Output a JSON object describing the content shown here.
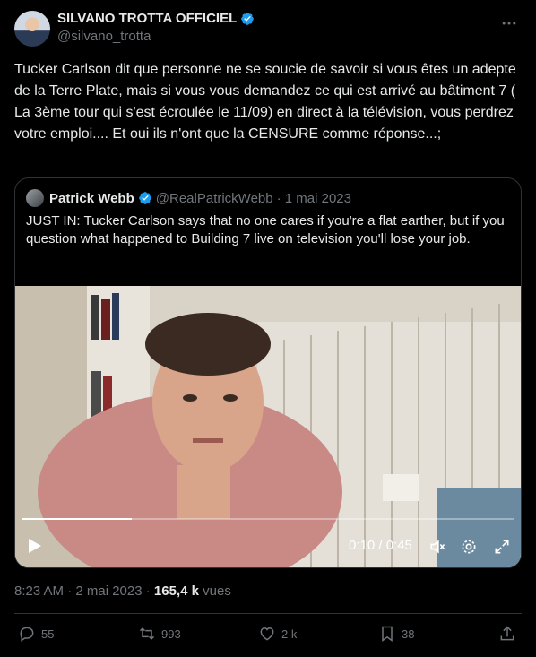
{
  "author": {
    "name": "SILVANO TROTTA OFFICIEL",
    "handle": "@silvano_trotta"
  },
  "tweet": {
    "text": "Tucker Carlson dit que personne ne se soucie de savoir si vous êtes un adepte de la Terre Plate, mais si vous vous demandez ce qui est arrivé au bâtiment 7 ( La 3ème tour qui s'est écroulée le 11/09) en direct à la télévision, vous perdrez votre emploi.... Et oui ils n'ont que la CENSURE comme réponse...;"
  },
  "quote": {
    "name": "Patrick Webb",
    "handle": "@RealPatrickWebb",
    "date": "· 1 mai 2023",
    "text": "JUST IN: Tucker Carlson says that no one cares if you're a flat earther, but if you question what happened to Building 7 live on television you'll lose your job."
  },
  "video": {
    "time_text": "0:10 / 0:45",
    "progress_fraction": 0.222
  },
  "meta": {
    "time": "8:23 AM · 2 mai 2023 · ",
    "views": "165,4 k",
    "views_label": " vues"
  },
  "actions": {
    "replies": "55",
    "reposts": "993",
    "likes": "2 k",
    "bookmarks": "38"
  },
  "colors": {
    "verified": "#1d9bf0",
    "text": "#e7e9ea",
    "muted": "#71767b",
    "border": "#2f3336"
  },
  "icons": [
    "verified-badge-icon",
    "more-icon",
    "play-icon",
    "volume-muted-icon",
    "settings-icon",
    "fullscreen-icon",
    "reply-icon",
    "repost-icon",
    "like-icon",
    "bookmark-icon",
    "share-icon"
  ]
}
